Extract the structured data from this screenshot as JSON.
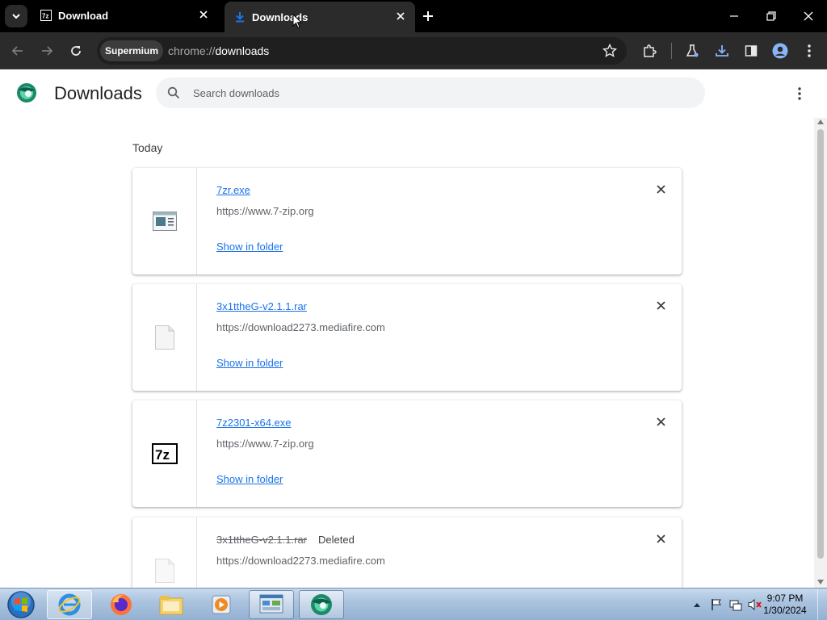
{
  "browser": {
    "tabs": [
      {
        "title": "Download",
        "favicon": "7zip-icon",
        "active": false
      },
      {
        "title": "Downloads",
        "favicon": "download-arrow-icon",
        "active": true
      }
    ],
    "omnibox": {
      "chip": "Supermium",
      "url_scheme": "chrome://",
      "url_path": "downloads"
    },
    "accent": "#1a73e8"
  },
  "page": {
    "title": "Downloads",
    "search_placeholder": "Search downloads",
    "section_label": "Today",
    "downloads": [
      {
        "name": "7zr.exe",
        "url": "https://www.7-zip.org",
        "action": "Show in folder",
        "icon": "executable-window-icon",
        "status": ""
      },
      {
        "name": "3x1ttheG-v2.1.1.rar",
        "url": "https://download2273.mediafire.com",
        "action": "Show in folder",
        "icon": "blank-file-icon",
        "status": ""
      },
      {
        "name": "7z2301-x64.exe",
        "url": "https://www.7-zip.org",
        "action": "Show in folder",
        "icon": "7zip-icon",
        "status": ""
      },
      {
        "name": "3x1ttheG-v2.1.1.rar",
        "url": "https://download2273.mediafire.com",
        "action": "",
        "icon": "blank-file-icon",
        "status": "Deleted"
      }
    ]
  },
  "taskbar": {
    "items": [
      "internet-explorer-icon",
      "firefox-icon",
      "file-explorer-icon",
      "media-player-icon",
      "control-panel-icon",
      "supermium-icon"
    ],
    "time": "9:07 PM",
    "date": "1/30/2024"
  }
}
